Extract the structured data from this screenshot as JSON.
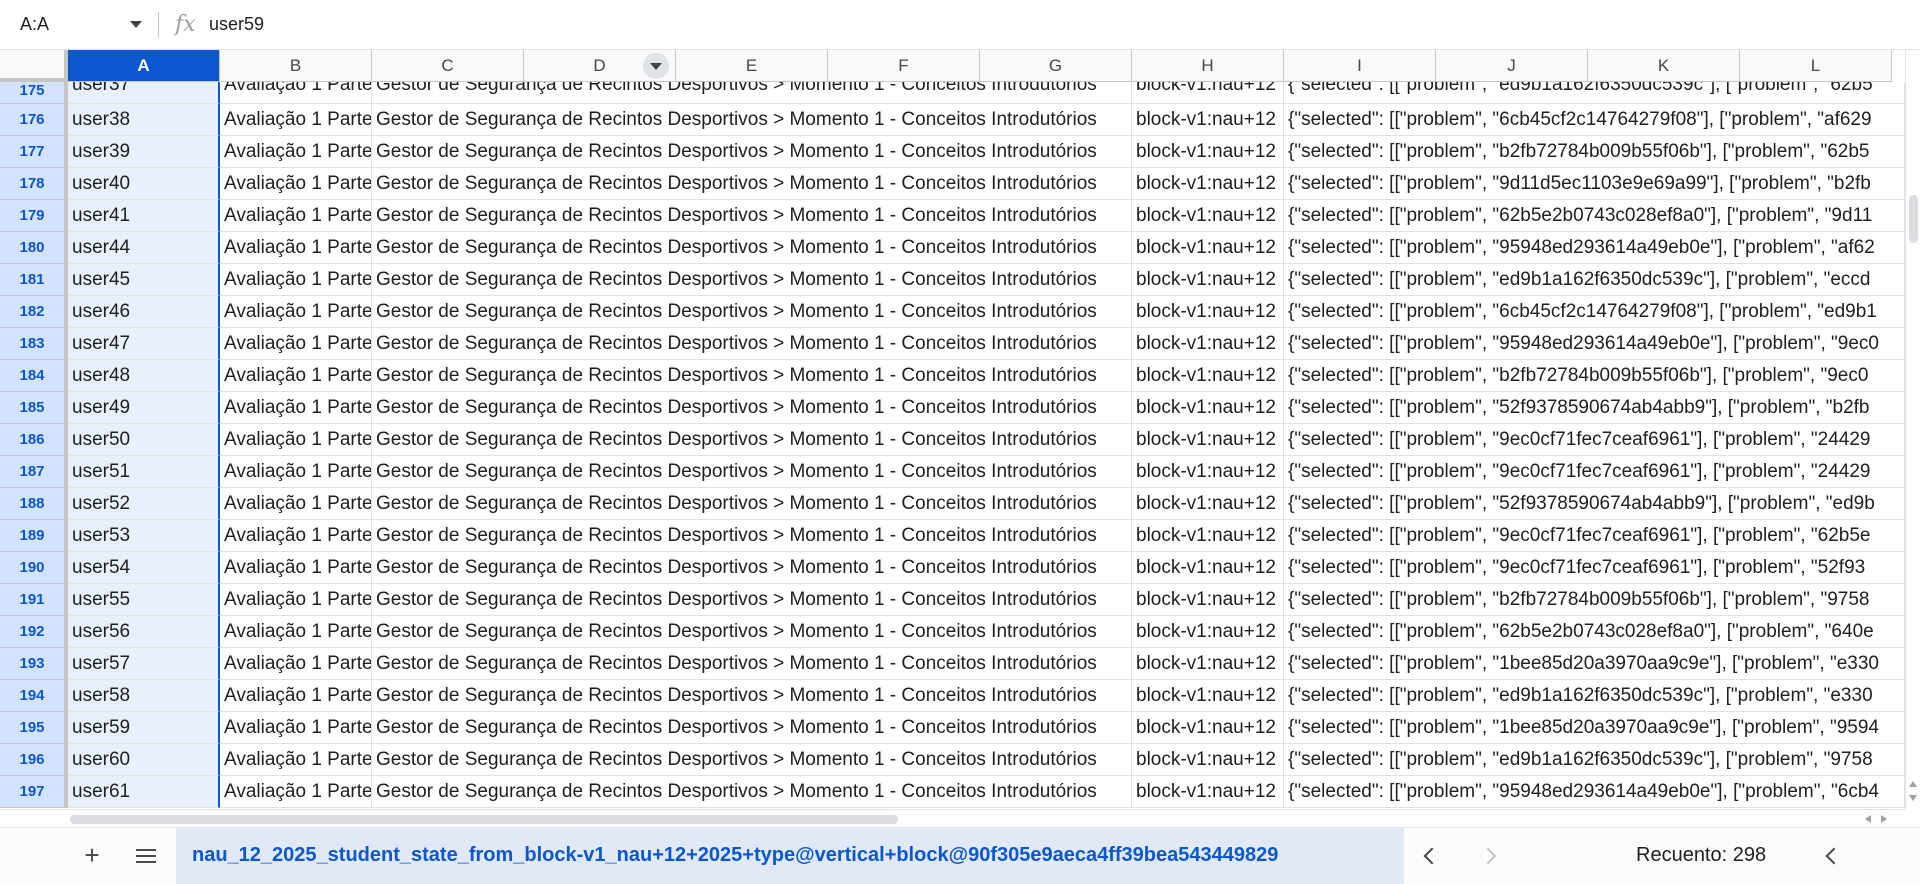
{
  "formula_bar": {
    "name_box": "A:A",
    "fx_label": "fx",
    "value": "user59"
  },
  "columns": [
    "A",
    "B",
    "C",
    "D",
    "E",
    "F",
    "G",
    "H",
    "I",
    "J",
    "K",
    "L"
  ],
  "selected_column": "A",
  "filter_column": "D",
  "rows": [
    {
      "n": "175",
      "a": "user37",
      "b": "Avaliação 1 Parte",
      "c": "Gestor de Segurança de Recintos Desportivos > Momento 1 - Conceitos Introdutórios",
      "h": "block-v1:nau+12",
      "i": "{\"selected\": [[\"problem\", \"ed9b1a162f6350dc539c\"], [\"problem\", \"62b5"
    },
    {
      "n": "176",
      "a": "user38",
      "b": "Avaliação 1 Parte",
      "c": "Gestor de Segurança de Recintos Desportivos > Momento 1 - Conceitos Introdutórios",
      "h": "block-v1:nau+12",
      "i": "{\"selected\": [[\"problem\", \"6cb45cf2c14764279f08\"], [\"problem\", \"af629"
    },
    {
      "n": "177",
      "a": "user39",
      "b": "Avaliação 1 Parte",
      "c": "Gestor de Segurança de Recintos Desportivos > Momento 1 - Conceitos Introdutórios",
      "h": "block-v1:nau+12",
      "i": "{\"selected\": [[\"problem\", \"b2fb72784b009b55f06b\"], [\"problem\", \"62b5"
    },
    {
      "n": "178",
      "a": "user40",
      "b": "Avaliação 1 Parte",
      "c": "Gestor de Segurança de Recintos Desportivos > Momento 1 - Conceitos Introdutórios",
      "h": "block-v1:nau+12",
      "i": "{\"selected\": [[\"problem\", \"9d11d5ec1103e9e69a99\"], [\"problem\", \"b2fb"
    },
    {
      "n": "179",
      "a": "user41",
      "b": "Avaliação 1 Parte",
      "c": "Gestor de Segurança de Recintos Desportivos > Momento 1 - Conceitos Introdutórios",
      "h": "block-v1:nau+12",
      "i": "{\"selected\": [[\"problem\", \"62b5e2b0743c028ef8a0\"], [\"problem\", \"9d11"
    },
    {
      "n": "180",
      "a": "user44",
      "b": "Avaliação 1 Parte",
      "c": "Gestor de Segurança de Recintos Desportivos > Momento 1 - Conceitos Introdutórios",
      "h": "block-v1:nau+12",
      "i": "{\"selected\": [[\"problem\", \"95948ed293614a49eb0e\"], [\"problem\", \"af62"
    },
    {
      "n": "181",
      "a": "user45",
      "b": "Avaliação 1 Parte",
      "c": "Gestor de Segurança de Recintos Desportivos > Momento 1 - Conceitos Introdutórios",
      "h": "block-v1:nau+12",
      "i": "{\"selected\": [[\"problem\", \"ed9b1a162f6350dc539c\"], [\"problem\", \"eccd"
    },
    {
      "n": "182",
      "a": "user46",
      "b": "Avaliação 1 Parte",
      "c": "Gestor de Segurança de Recintos Desportivos > Momento 1 - Conceitos Introdutórios",
      "h": "block-v1:nau+12",
      "i": "{\"selected\": [[\"problem\", \"6cb45cf2c14764279f08\"], [\"problem\", \"ed9b1"
    },
    {
      "n": "183",
      "a": "user47",
      "b": "Avaliação 1 Parte",
      "c": "Gestor de Segurança de Recintos Desportivos > Momento 1 - Conceitos Introdutórios",
      "h": "block-v1:nau+12",
      "i": "{\"selected\": [[\"problem\", \"95948ed293614a49eb0e\"], [\"problem\", \"9ec0"
    },
    {
      "n": "184",
      "a": "user48",
      "b": "Avaliação 1 Parte",
      "c": "Gestor de Segurança de Recintos Desportivos > Momento 1 - Conceitos Introdutórios",
      "h": "block-v1:nau+12",
      "i": "{\"selected\": [[\"problem\", \"b2fb72784b009b55f06b\"], [\"problem\", \"9ec0"
    },
    {
      "n": "185",
      "a": "user49",
      "b": "Avaliação 1 Parte",
      "c": "Gestor de Segurança de Recintos Desportivos > Momento 1 - Conceitos Introdutórios",
      "h": "block-v1:nau+12",
      "i": "{\"selected\": [[\"problem\", \"52f9378590674ab4abb9\"], [\"problem\", \"b2fb"
    },
    {
      "n": "186",
      "a": "user50",
      "b": "Avaliação 1 Parte",
      "c": "Gestor de Segurança de Recintos Desportivos > Momento 1 - Conceitos Introdutórios",
      "h": "block-v1:nau+12",
      "i": "{\"selected\": [[\"problem\", \"9ec0cf71fec7ceaf6961\"], [\"problem\", \"24429"
    },
    {
      "n": "187",
      "a": "user51",
      "b": "Avaliação 1 Parte",
      "c": "Gestor de Segurança de Recintos Desportivos > Momento 1 - Conceitos Introdutórios",
      "h": "block-v1:nau+12",
      "i": "{\"selected\": [[\"problem\", \"9ec0cf71fec7ceaf6961\"], [\"problem\", \"24429"
    },
    {
      "n": "188",
      "a": "user52",
      "b": "Avaliação 1 Parte",
      "c": "Gestor de Segurança de Recintos Desportivos > Momento 1 - Conceitos Introdutórios",
      "h": "block-v1:nau+12",
      "i": "{\"selected\": [[\"problem\", \"52f9378590674ab4abb9\"], [\"problem\", \"ed9b"
    },
    {
      "n": "189",
      "a": "user53",
      "b": "Avaliação 1 Parte",
      "c": "Gestor de Segurança de Recintos Desportivos > Momento 1 - Conceitos Introdutórios",
      "h": "block-v1:nau+12",
      "i": "{\"selected\": [[\"problem\", \"9ec0cf71fec7ceaf6961\"], [\"problem\", \"62b5e"
    },
    {
      "n": "190",
      "a": "user54",
      "b": "Avaliação 1 Parte",
      "c": "Gestor de Segurança de Recintos Desportivos > Momento 1 - Conceitos Introdutórios",
      "h": "block-v1:nau+12",
      "i": "{\"selected\": [[\"problem\", \"9ec0cf71fec7ceaf6961\"], [\"problem\", \"52f93"
    },
    {
      "n": "191",
      "a": "user55",
      "b": "Avaliação 1 Parte",
      "c": "Gestor de Segurança de Recintos Desportivos > Momento 1 - Conceitos Introdutórios",
      "h": "block-v1:nau+12",
      "i": "{\"selected\": [[\"problem\", \"b2fb72784b009b55f06b\"], [\"problem\", \"9758"
    },
    {
      "n": "192",
      "a": "user56",
      "b": "Avaliação 1 Parte",
      "c": "Gestor de Segurança de Recintos Desportivos > Momento 1 - Conceitos Introdutórios",
      "h": "block-v1:nau+12",
      "i": "{\"selected\": [[\"problem\", \"62b5e2b0743c028ef8a0\"], [\"problem\", \"640e"
    },
    {
      "n": "193",
      "a": "user57",
      "b": "Avaliação 1 Parte",
      "c": "Gestor de Segurança de Recintos Desportivos > Momento 1 - Conceitos Introdutórios",
      "h": "block-v1:nau+12",
      "i": "{\"selected\": [[\"problem\", \"1bee85d20a3970aa9c9e\"], [\"problem\", \"e330"
    },
    {
      "n": "194",
      "a": "user58",
      "b": "Avaliação 1 Parte",
      "c": "Gestor de Segurança de Recintos Desportivos > Momento 1 - Conceitos Introdutórios",
      "h": "block-v1:nau+12",
      "i": "{\"selected\": [[\"problem\", \"ed9b1a162f6350dc539c\"], [\"problem\", \"e330"
    },
    {
      "n": "195",
      "a": "user59",
      "b": "Avaliação 1 Parte",
      "c": "Gestor de Segurança de Recintos Desportivos > Momento 1 - Conceitos Introdutórios",
      "h": "block-v1:nau+12",
      "i": "{\"selected\": [[\"problem\", \"1bee85d20a3970aa9c9e\"], [\"problem\", \"9594"
    },
    {
      "n": "196",
      "a": "user60",
      "b": "Avaliação 1 Parte",
      "c": "Gestor de Segurança de Recintos Desportivos > Momento 1 - Conceitos Introdutórios",
      "h": "block-v1:nau+12",
      "i": "{\"selected\": [[\"problem\", \"ed9b1a162f6350dc539c\"], [\"problem\", \"9758"
    },
    {
      "n": "197",
      "a": "user61",
      "b": "Avaliação 1 Parte",
      "c": "Gestor de Segurança de Recintos Desportivos > Momento 1 - Conceitos Introdutórios",
      "h": "block-v1:nau+12",
      "i": "{\"selected\": [[\"problem\", \"95948ed293614a49eb0e\"], [\"problem\", \"6cb4"
    }
  ],
  "sheet_bar": {
    "add_icon": "plus-icon",
    "list_icon": "sheet-list-icon",
    "active_sheet": "nau_12_2025_student_state_from_block-v1_nau+12+2025+type@vertical+block@90f305e9aeca4ff39bea543449829",
    "count_label": "Recuento: 298"
  },
  "colors": {
    "selection": "#0b57d0",
    "selected_row_header": "#d3e3fd",
    "selected_cell_bg": "#e8f0fe"
  }
}
